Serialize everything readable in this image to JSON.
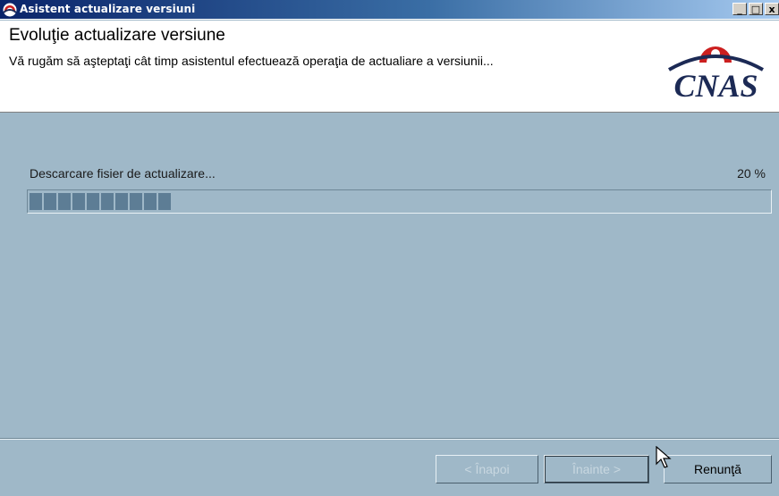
{
  "window": {
    "title": "Asistent actualizare versiuni",
    "minimize_glyph": "_",
    "maximize_glyph": "□",
    "close_glyph": "x"
  },
  "header": {
    "title": "Evoluţie actualizare versiune",
    "subtitle": "Vă rugăm să aşteptaţi cât timp asistentul efectuează operaţia de actualiare a versiunii...",
    "logo_text": "CNAS",
    "logo_icon": "cnas-logo-arc-icon"
  },
  "progress": {
    "status_label": "Descarcare fisier de actualizare...",
    "percent_label": "20 %",
    "fraction": 0.2
  },
  "buttons": {
    "back_label": "< Înapoi",
    "next_label": "Înainte >",
    "cancel_label": "Renunţă"
  },
  "colors": {
    "background": "#9fb8c8",
    "progress_fill": "#5d7d95",
    "title_bar": "#0a246a",
    "logo_red": "#cc1f1f",
    "logo_navy": "#1c2a55"
  }
}
